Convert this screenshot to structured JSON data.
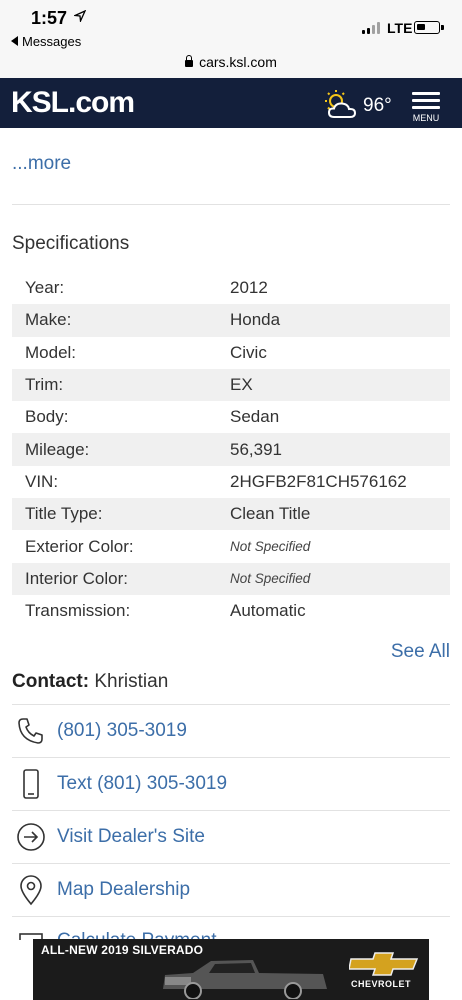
{
  "status_bar": {
    "time": "1:57",
    "back_label": "Messages",
    "network": "LTE"
  },
  "browser": {
    "url": "cars.ksl.com"
  },
  "header": {
    "logo": "KSL.com",
    "temperature": "96°",
    "menu_label": "MENU"
  },
  "description": {
    "more_link": "...more"
  },
  "specifications": {
    "title": "Specifications",
    "rows": [
      {
        "label": "Year:",
        "value": "2012"
      },
      {
        "label": "Make:",
        "value": "Honda"
      },
      {
        "label": "Model:",
        "value": "Civic"
      },
      {
        "label": "Trim:",
        "value": "EX"
      },
      {
        "label": "Body:",
        "value": "Sedan"
      },
      {
        "label": "Mileage:",
        "value": "56,391"
      },
      {
        "label": "VIN:",
        "value": "2HGFB2F81CH576162"
      },
      {
        "label": "Title Type:",
        "value": "Clean Title"
      },
      {
        "label": "Exterior Color:",
        "value": "Not Specified"
      },
      {
        "label": "Interior Color:",
        "value": "Not Specified"
      },
      {
        "label": "Transmission:",
        "value": "Automatic"
      }
    ],
    "see_all": "See All"
  },
  "contact": {
    "label": "Contact:",
    "name": "Khristian",
    "actions": [
      {
        "icon": "phone-icon",
        "label": "(801) 305-3019"
      },
      {
        "icon": "mobile-icon",
        "label": "Text (801) 305-3019"
      },
      {
        "icon": "arrow-circle-icon",
        "label": "Visit Dealer's Site"
      },
      {
        "icon": "map-pin-icon",
        "label": "Map Dealership"
      },
      {
        "icon": "calculator-icon",
        "label": "Calculate Payment"
      }
    ]
  },
  "ad": {
    "headline": "ALL-NEW 2019 SILVERADO",
    "brand": "CHEVROLET"
  },
  "colors": {
    "header_bg": "#131f3b",
    "link": "#3c6ea8",
    "row_shade": "#f0f0f0"
  }
}
